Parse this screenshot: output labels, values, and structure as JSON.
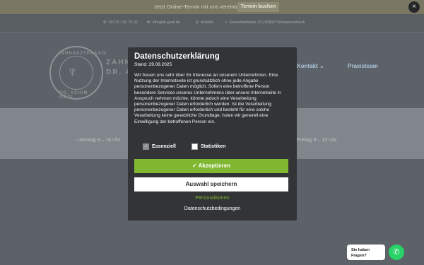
{
  "banner": {
    "text": "Jetzt Online-Termin mit uns vereinbaren!",
    "button": "Termin buchen",
    "close": "×"
  },
  "contact": {
    "phone": "09176 / 92 70 92",
    "email": "info@dr-godl.de",
    "directions": "Anfahrt",
    "address": "Gewerbestraße 23 | 90592 Schwarzenbruck"
  },
  "brand": {
    "logo_top": "ZAHNARZTPRAXIS",
    "logo_bottom": "DR. ACHIM GÖDL",
    "line1": "ZAHNA",
    "line2": "DR. ACH"
  },
  "nav": {
    "contact": "Kontakt",
    "team": "Praxisteam"
  },
  "hours": {
    "left": "Montag 8 – 16 Uhr",
    "right": "Freitag 8 – 13 Uhr"
  },
  "modal": {
    "title": "Datenschutzerklärung",
    "date": "Stand: 29.08.2025",
    "body": "Wir freuen uns sehr über Ihr Interesse an unserem Unternehmen. Eine Nutzung der Internetseite ist grundsätzlich ohne jede Angabe personenbezogener Daten möglich. Sofern eine betroffene Person besondere Services unseres Unternehmens über unsere Internetseite in Anspruch nehmen möchte, könnte jedoch eine Verarbeitung personenbezogener Daten erforderlich werden. Ist die Verarbeitung personenbezogener Daten erforderlich und besteht für eine solche Verarbeitung keine gesetzliche Grundlage, holen wir generell eine Einwilligung der betroffenen Person ein.",
    "opt_essential": "Essenziell",
    "opt_stats": "Statistiken",
    "accept": "✓ Akzeptieren",
    "save": "Auswahl speichern",
    "personalize": "Personalisieren",
    "terms": "Datenschutzbedingungen"
  },
  "whatsapp": {
    "line1": "Sie haben",
    "line2": "Fragen?"
  },
  "colors": {
    "accent_green": "#81b832",
    "modal_bg": "#323436",
    "whatsapp": "#25d366"
  }
}
